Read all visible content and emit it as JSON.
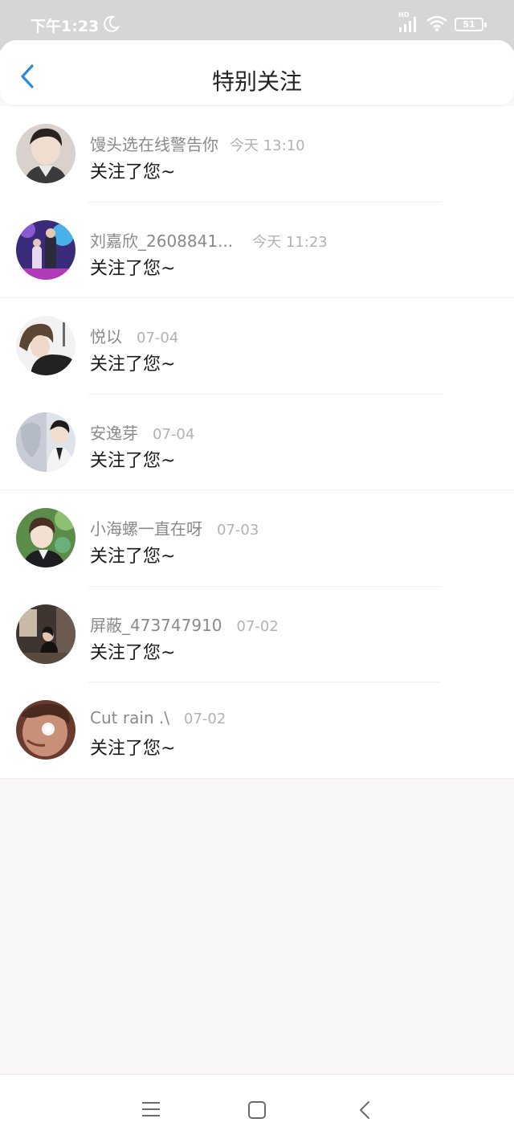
{
  "status_bar": {
    "time": "下午1:23",
    "hd_label": "HD",
    "battery": "51"
  },
  "header": {
    "title": "特别关注",
    "accent_color": "#2b8ae0"
  },
  "items": [
    {
      "name": "馒头选在线警告你",
      "time": "今天 13:10",
      "message": "关注了您~"
    },
    {
      "name": "刘嘉欣_2608841...",
      "time": "今天 11:23",
      "message": "关注了您~"
    },
    {
      "name": "悦以",
      "time": "07-04",
      "message": "关注了您~"
    },
    {
      "name": "安逸芽",
      "time": "07-04",
      "message": "关注了您~"
    },
    {
      "name": "小海螺一直在呀",
      "time": "07-03",
      "message": "关注了您~"
    },
    {
      "name": "屏蔽_473747910",
      "time": "07-02",
      "message": "关注了您~"
    },
    {
      "name": "Cut rain .\\",
      "time": "07-02",
      "message": "关注了您~"
    }
  ],
  "nav": {
    "icons": [
      "menu-icon",
      "home-square-icon",
      "back-chevron-icon"
    ]
  }
}
